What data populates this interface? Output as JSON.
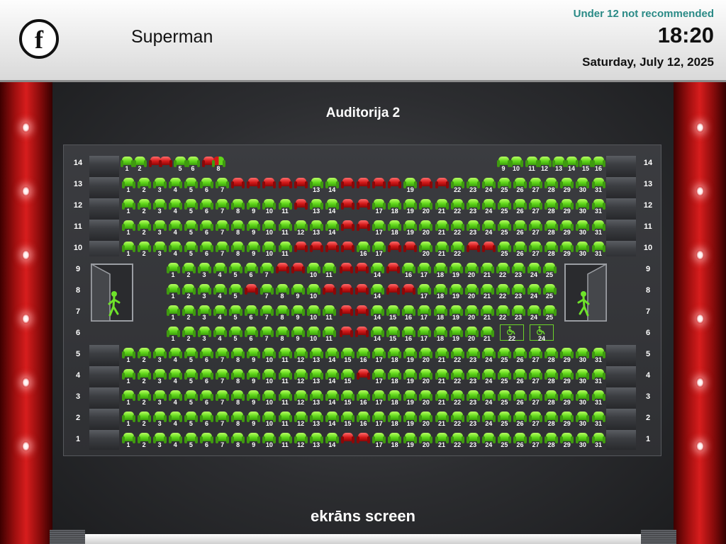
{
  "header": {
    "logo_letter": "f",
    "movie_title": "Superman",
    "age_rating": "Under 12 not recommended",
    "showtime": "18:20",
    "date": "Saturday, July 12, 2025"
  },
  "auditorium": {
    "title": "Auditorija 2"
  },
  "screen_label": "ekrāns screen",
  "colors": {
    "free_seat": "#5fd61a",
    "taken_seat": "#d11818",
    "rating_text": "#2a8a86"
  },
  "icons": {
    "exit": "exit-person-icon",
    "wheelchair": "wheelchair-icon",
    "logo": "logo-icon"
  },
  "row_labels": [
    "14",
    "13",
    "12",
    "11",
    "10",
    "9",
    "8",
    "7",
    "6",
    "5",
    "4",
    "3",
    "2",
    "1"
  ],
  "seats": {
    "row14": {
      "free": [
        "1",
        "2",
        "5",
        "6",
        "9",
        "10",
        "11",
        "12",
        "13",
        "14",
        "15",
        "16"
      ],
      "taken": [
        "3",
        "4",
        "7"
      ],
      "partial": [
        "8"
      ]
    },
    "row13": {
      "free": [
        "1",
        "2",
        "3",
        "4",
        "5",
        "6",
        "7",
        "13",
        "14",
        "19",
        "22",
        "23",
        "24",
        "25",
        "26",
        "27",
        "28",
        "29",
        "30",
        "31"
      ],
      "taken": [
        "8",
        "9",
        "10",
        "11",
        "12",
        "15",
        "16",
        "17",
        "18",
        "20",
        "21"
      ]
    },
    "row12": {
      "free": [
        "1",
        "2",
        "3",
        "4",
        "5",
        "6",
        "7",
        "8",
        "9",
        "10",
        "11",
        "13",
        "14",
        "17",
        "18",
        "19",
        "20",
        "21",
        "22",
        "23",
        "24",
        "25",
        "26",
        "27",
        "28",
        "29",
        "30",
        "31"
      ],
      "taken": [
        "12",
        "15",
        "16"
      ]
    },
    "row11": {
      "free": [
        "1",
        "2",
        "3",
        "4",
        "5",
        "6",
        "7",
        "8",
        "9",
        "10",
        "11",
        "12",
        "13",
        "14",
        "17",
        "18",
        "19",
        "20",
        "21",
        "22",
        "23",
        "24",
        "25",
        "26",
        "27",
        "28",
        "29",
        "30",
        "31"
      ],
      "taken": [
        "15",
        "16"
      ]
    },
    "row10": {
      "free": [
        "1",
        "2",
        "3",
        "4",
        "5",
        "6",
        "7",
        "8",
        "9",
        "10",
        "11",
        "16",
        "17",
        "20",
        "21",
        "22",
        "25",
        "26",
        "27",
        "28",
        "29",
        "30",
        "31"
      ],
      "taken": [
        "12",
        "13",
        "14",
        "15",
        "18",
        "19",
        "23",
        "24"
      ]
    },
    "row9": {
      "free": [
        "1",
        "2",
        "3",
        "4",
        "5",
        "6",
        "7",
        "10",
        "11",
        "14",
        "16",
        "17",
        "18",
        "19",
        "20",
        "21",
        "22",
        "23",
        "24",
        "25"
      ],
      "taken": [
        "8",
        "9",
        "12",
        "13",
        "15"
      ]
    },
    "row8": {
      "free": [
        "1",
        "2",
        "3",
        "4",
        "5",
        "7",
        "8",
        "9",
        "10",
        "14",
        "17",
        "18",
        "19",
        "20",
        "21",
        "22",
        "23",
        "24",
        "25"
      ],
      "taken": [
        "6",
        "11",
        "12",
        "13",
        "15",
        "16"
      ]
    },
    "row7": {
      "free": [
        "1",
        "2",
        "3",
        "4",
        "5",
        "6",
        "7",
        "8",
        "9",
        "10",
        "11",
        "14",
        "15",
        "16",
        "17",
        "18",
        "19",
        "20",
        "21",
        "22",
        "23",
        "24",
        "25"
      ],
      "taken": [
        "12",
        "13"
      ]
    },
    "row6": {
      "free": [
        "1",
        "2",
        "3",
        "4",
        "5",
        "6",
        "7",
        "8",
        "9",
        "10",
        "11",
        "14",
        "15",
        "16",
        "17",
        "18",
        "19",
        "20",
        "21"
      ],
      "taken": [
        "12",
        "13"
      ],
      "wheelchair": [
        "22",
        "24"
      ]
    },
    "row5": {
      "free": [
        "1",
        "2",
        "3",
        "4",
        "5",
        "6",
        "7",
        "8",
        "9",
        "10",
        "11",
        "12",
        "13",
        "14",
        "15",
        "16",
        "17",
        "18",
        "19",
        "20",
        "21",
        "22",
        "23",
        "24",
        "25",
        "26",
        "27",
        "28",
        "29",
        "30",
        "31"
      ],
      "taken": []
    },
    "row4": {
      "free": [
        "1",
        "2",
        "3",
        "4",
        "5",
        "6",
        "7",
        "8",
        "9",
        "10",
        "11",
        "12",
        "13",
        "14",
        "15",
        "17",
        "18",
        "19",
        "20",
        "21",
        "22",
        "23",
        "24",
        "25",
        "26",
        "27",
        "28",
        "29",
        "30",
        "31"
      ],
      "taken": [
        "16"
      ]
    },
    "row3": {
      "free": [
        "1",
        "2",
        "3",
        "4",
        "5",
        "6",
        "7",
        "8",
        "9",
        "10",
        "11",
        "12",
        "13",
        "14",
        "15",
        "16",
        "17",
        "18",
        "19",
        "20",
        "21",
        "22",
        "23",
        "24",
        "25",
        "26",
        "27",
        "28",
        "29",
        "30",
        "31"
      ],
      "taken": []
    },
    "row2": {
      "free": [
        "1",
        "2",
        "3",
        "4",
        "5",
        "6",
        "7",
        "8",
        "9",
        "10",
        "11",
        "12",
        "13",
        "14",
        "15",
        "16",
        "17",
        "18",
        "19",
        "20",
        "21",
        "22",
        "23",
        "24",
        "25",
        "26",
        "27",
        "28",
        "29",
        "30",
        "31"
      ],
      "taken": []
    },
    "row1": {
      "free": [
        "1",
        "2",
        "3",
        "4",
        "5",
        "6",
        "7",
        "8",
        "9",
        "10",
        "11",
        "12",
        "13",
        "14",
        "17",
        "18",
        "19",
        "20",
        "21",
        "22",
        "23",
        "24",
        "25",
        "26",
        "27",
        "28",
        "29",
        "30",
        "31"
      ],
      "taken": [
        "15",
        "16"
      ]
    }
  }
}
